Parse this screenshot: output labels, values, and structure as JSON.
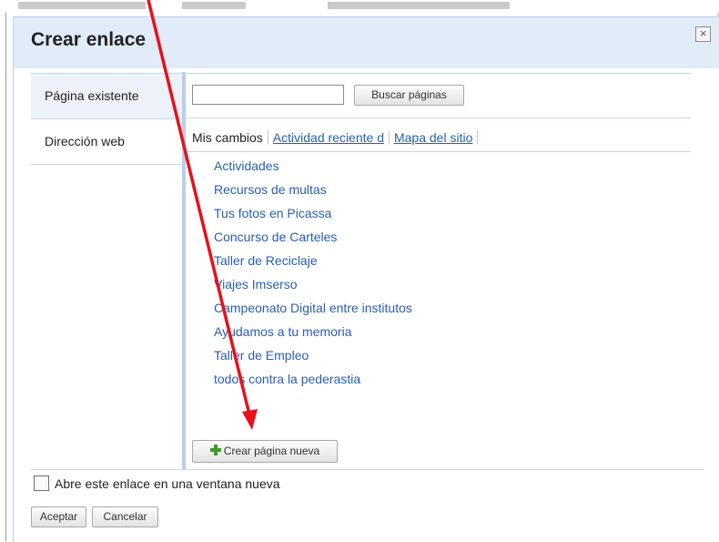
{
  "dialog": {
    "title": "Crear enlace",
    "close_glyph": "×"
  },
  "sidebar": {
    "items": [
      {
        "label": "Página existente",
        "selected": true
      },
      {
        "label": "Dirección web",
        "selected": false
      }
    ]
  },
  "search": {
    "value": "",
    "button_label": "Buscar páginas"
  },
  "tabs": [
    {
      "label": "Mis cambios",
      "active": true
    },
    {
      "label": "Actividad reciente d",
      "active": false
    },
    {
      "label": "Mapa del sitio",
      "active": false
    }
  ],
  "pages": [
    "Actividades",
    "Recursos de multas",
    "Tus fotos en Picassa",
    "Concurso de Carteles",
    "Taller de Reciclaje",
    "Viajes Imserso",
    "Campeonato Digital entre institutos",
    "Ayudamos a tu memoria",
    "Taller de Empleo",
    "todos contra la pederastia"
  ],
  "new_page_button": {
    "label": "Crear página nueva",
    "icon": "plus-icon"
  },
  "new_window_checkbox": {
    "label": "Abre este enlace en una ventana nueva",
    "checked": false
  },
  "footer": {
    "ok_label": "Aceptar",
    "cancel_label": "Cancelar"
  },
  "colors": {
    "link": "#2a5db0",
    "title_bar": "#e2ebf8",
    "annotation_arrow": "#e8101a",
    "plus_icon": "#3f9a2e"
  }
}
